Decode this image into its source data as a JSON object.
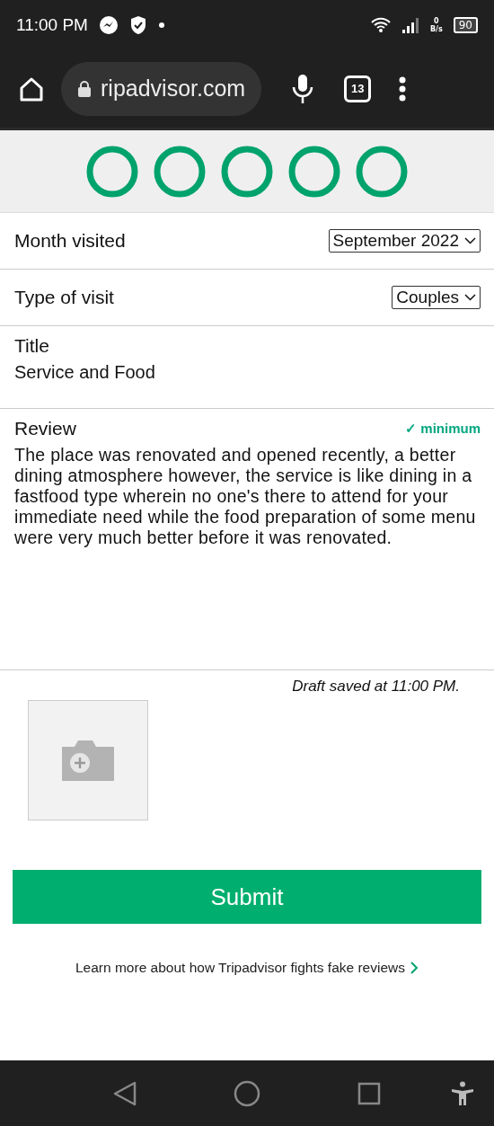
{
  "status_bar": {
    "time": "11:00 PM",
    "data_rate": "0",
    "data_unit": "B/s",
    "battery": "90"
  },
  "browser": {
    "url": "ripadvisor.com",
    "tab_count": "13"
  },
  "rating": {
    "stars": 0
  },
  "fields": [
    {
      "kind": "select",
      "label": "Month visited",
      "value": "September 2022"
    },
    {
      "kind": "select",
      "label": "Type of visit",
      "value": "Couples"
    },
    {
      "kind": "text",
      "label": "Title",
      "value": "Service and Food"
    },
    {
      "kind": "textarea",
      "label": "Review",
      "badge": "✓ minimum",
      "value": "The place was renovated and opened recently, a better dining atmosphere however, the service is like dining in a fastfood type wherein no one's there to attend for your immediate need while the food preparation of some menu were very much better before it was renovated."
    }
  ],
  "draft_status": "Draft saved at 11:00 PM.",
  "submit": "Submit",
  "learn_more": "Learn more about how Tripadvisor fights fake reviews"
}
